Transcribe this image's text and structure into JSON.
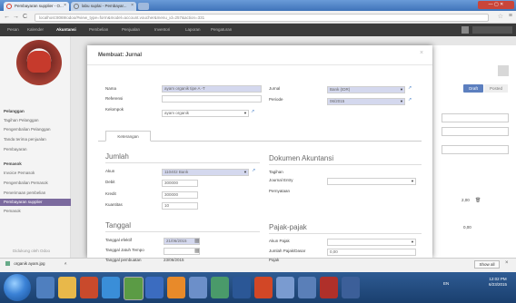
{
  "browser": {
    "tabs": [
      {
        "label": "Pembayaran supplier - O..."
      },
      {
        "label": "labu suplai - Pembayar..."
      }
    ],
    "url": "localhost:8069/odoo/#view_type=form&model=account.voucher&menu_id=257&action=331",
    "window_controls": "— ▢ ✕"
  },
  "topmenu": {
    "items": [
      "Pesan",
      "Kalender",
      "Akuntansi",
      "Pembelian",
      "Penjualan",
      "Inventori",
      "Laporan",
      "Pengaturan"
    ]
  },
  "sidebar": {
    "items": [
      {
        "label": "Pelanggan",
        "kind": "head"
      },
      {
        "label": "Tagihan Pelanggan"
      },
      {
        "label": "Pengembalian Pelanggan"
      },
      {
        "label": "Tanda terima penjualan"
      },
      {
        "label": "Pembayaran"
      },
      {
        "label": "Pemasok",
        "kind": "head"
      },
      {
        "label": "Invoice Pemasok"
      },
      {
        "label": "Pengembalian Pemasok"
      },
      {
        "label": "Penerimaan pembelian"
      },
      {
        "label": "Pembayaran supplier",
        "kind": "active"
      },
      {
        "label": "Pemasok"
      },
      {
        "label": "Didukung oleh Odoo"
      }
    ]
  },
  "background": {
    "draft_label": "Draft",
    "posted_label": "Posted",
    "amount_1": "2,00",
    "amount_2": "0,00"
  },
  "modal": {
    "title": "Membuat: Jurnal",
    "close": "×",
    "fields": {
      "nama": {
        "label": "Nama",
        "value": "ayam organik tipe A -T"
      },
      "referensi": {
        "label": "Referensi",
        "value": ""
      },
      "kelompok": {
        "label": "Kelompok",
        "value": "ayam organik"
      },
      "jurnal": {
        "label": "Jurnal",
        "value": "Bank (IDR)"
      },
      "periode": {
        "label": "Periode",
        "value": "06/2015"
      }
    },
    "tab_label": "Keterangan",
    "jumlah": {
      "title": "Jumlah",
      "akun": {
        "label": "Akun",
        "value": "110402 Bank"
      },
      "debit": {
        "label": "Debit",
        "value": "300000"
      },
      "kredit": {
        "label": "Kredit",
        "value": "300000"
      },
      "kuantitas": {
        "label": "Kuantitas",
        "value": "10"
      }
    },
    "dokumen": {
      "title": "Dokumen Akuntansi",
      "tagihan": {
        "label": "Tagihan"
      },
      "jurnal_entry": {
        "label": "Journal Entry",
        "value": ""
      },
      "pernyataan": {
        "label": "Pernyataan"
      }
    },
    "tanggal": {
      "title": "Tanggal",
      "efektif": {
        "label": "Tanggal efektif",
        "value": "21/06/2015"
      },
      "jatuh_tempo": {
        "label": "Tanggal Jatuh Tempo",
        "value": ""
      },
      "pembuatan": {
        "label": "Tanggal pembuatan",
        "value": "23/06/2015"
      }
    },
    "pajak": {
      "title": "Pajak-pajak",
      "akun_pajak": {
        "label": "Akun Pajak",
        "value": ""
      },
      "jumlah_pajak": {
        "label": "Jumlah Pajak/Dasar",
        "value": "0,00"
      },
      "pajak": {
        "label": "Pajak",
        "value": ""
      }
    }
  },
  "downloads": {
    "file": "organik ayam.jpg",
    "show_all": "Show all",
    "close": "×"
  },
  "taskbar": {
    "tray": "EN",
    "time": "12:02 PM",
    "date": "6/23/2015"
  },
  "colors": {
    "accent": "#7b6a9e",
    "required_field": "#d4d8ee",
    "link": "#3877c4",
    "primary_button": "#5c7fbf"
  }
}
